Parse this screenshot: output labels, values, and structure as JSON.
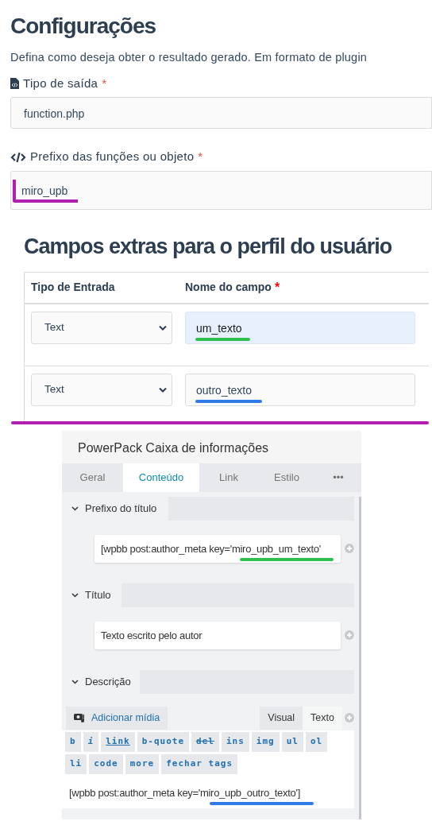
{
  "settings": {
    "title": "Configurações",
    "description": "Defina como deseja obter o resultado gerado. Em formato de plugin",
    "fields": [
      {
        "kind": "file",
        "label": "Tipo de saída",
        "required_mark": "*",
        "value": "function.php"
      },
      {
        "kind": "code",
        "label": "Prefixo das funções ou objeto",
        "required_mark": "*",
        "value": "miro_upb",
        "color": "#b01fb0"
      }
    ]
  },
  "extra_fields": {
    "title": "Campos extras para o perfil do usuário",
    "columns": [
      {
        "label": "Tipo de Entrada"
      },
      {
        "label": "Nome do campo",
        "required_mark": "*"
      }
    ],
    "rows": [
      {
        "type": "Text",
        "name": "um_texto",
        "focused": true,
        "color": "#2fbf4f"
      },
      {
        "type": "Text",
        "name": "outro_texto",
        "focused": false,
        "color": "#2f7be8"
      }
    ],
    "color": "#b01fb0"
  },
  "panel": {
    "title": "PowerPack Caixa de informações",
    "tabs": [
      {
        "label": "Geral",
        "selected": false
      },
      {
        "label": "Conteúdo",
        "selected": true
      },
      {
        "label": "Link",
        "selected": false
      },
      {
        "label": "Estilo",
        "selected": false
      },
      {
        "label": "•••",
        "selected": false
      }
    ],
    "sections": [
      {
        "title": "Prefixo do título",
        "expanded": true,
        "value_prefix": "[wpbb post:author_meta key='",
        "value_key": "miro_upb_um_texto'",
        "color": "#2fbf4f"
      },
      {
        "title": "Título",
        "expanded": true,
        "value_prefix": "Texto escrito pelo autor"
      }
    ],
    "description": {
      "title": "Descrição",
      "expanded": true,
      "media_button": "Adicionar mídia",
      "modes": [
        {
          "label": "Visual",
          "selected": false
        },
        {
          "label": "Texto",
          "selected": true
        }
      ],
      "quicktags": [
        {
          "label": "b",
          "kind": "plain"
        },
        {
          "label": "i",
          "kind": "italic"
        },
        {
          "label": "link",
          "kind": "underline"
        },
        {
          "label": "b-quote",
          "kind": "plain"
        },
        {
          "label": "del",
          "kind": "strike"
        },
        {
          "label": "ins",
          "kind": "plain"
        },
        {
          "label": "img",
          "kind": "plain"
        },
        {
          "label": "ul",
          "kind": "plain"
        },
        {
          "label": "ol",
          "kind": "plain"
        },
        {
          "label": "li",
          "kind": "plain"
        },
        {
          "label": "code",
          "kind": "plain"
        },
        {
          "label": "more",
          "kind": "plain"
        },
        {
          "label": "fechar tags",
          "kind": "plain"
        }
      ],
      "content_prefix": "[wpbb post:author_meta key='",
      "content_key": "miro_upb_outro_texto'",
      "content_suffix": "]",
      "color": "#2f7be8"
    }
  }
}
